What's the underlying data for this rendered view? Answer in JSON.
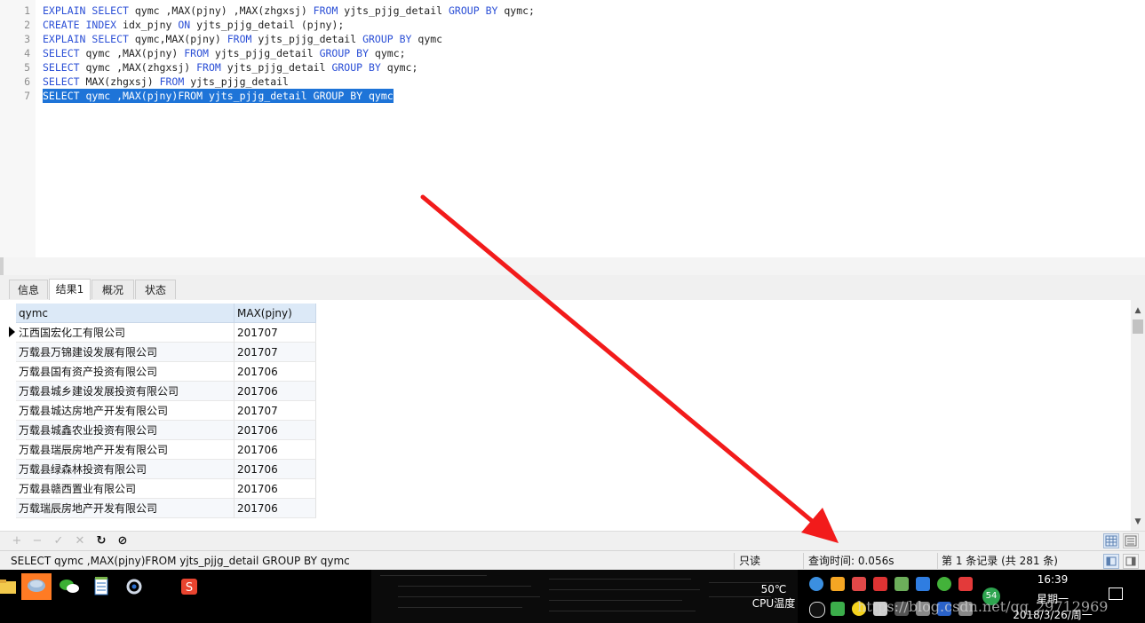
{
  "editor": {
    "lines": [
      {
        "n": "1",
        "tokens": [
          [
            "kw",
            "EXPLAIN"
          ],
          [
            "t",
            " "
          ],
          [
            "kw",
            "SELECT"
          ],
          [
            "t",
            " qymc ,MAX(pjny) ,MAX(zhgxsj) "
          ],
          [
            "kw",
            "FROM"
          ],
          [
            "t",
            " yjts_pjjg_detail "
          ],
          [
            "kw",
            "GROUP"
          ],
          [
            "t",
            " "
          ],
          [
            "kw",
            "BY"
          ],
          [
            "t",
            " qymc;"
          ]
        ]
      },
      {
        "n": "2",
        "tokens": [
          [
            "kw",
            "CREATE"
          ],
          [
            "t",
            " "
          ],
          [
            "kw",
            "INDEX"
          ],
          [
            "t",
            " idx_pjny "
          ],
          [
            "kw",
            "ON"
          ],
          [
            "t",
            " yjts_pjjg_detail (pjny);"
          ]
        ]
      },
      {
        "n": "3",
        "tokens": [
          [
            "kw",
            "EXPLAIN"
          ],
          [
            "t",
            " "
          ],
          [
            "kw",
            "SELECT"
          ],
          [
            "t",
            " qymc,MAX(pjny) "
          ],
          [
            "kw",
            "FROM"
          ],
          [
            "t",
            " yjts_pjjg_detail "
          ],
          [
            "kw",
            "GROUP"
          ],
          [
            "t",
            " "
          ],
          [
            "kw",
            "BY"
          ],
          [
            "t",
            " qymc"
          ]
        ]
      },
      {
        "n": "4",
        "tokens": [
          [
            "kw",
            "SELECT"
          ],
          [
            "t",
            " qymc ,MAX(pjny) "
          ],
          [
            "kw",
            "FROM"
          ],
          [
            "t",
            " yjts_pjjg_detail "
          ],
          [
            "kw",
            "GROUP"
          ],
          [
            "t",
            " "
          ],
          [
            "kw",
            "BY"
          ],
          [
            "t",
            " qymc;"
          ]
        ]
      },
      {
        "n": "5",
        "tokens": [
          [
            "kw",
            "SELECT"
          ],
          [
            "t",
            " qymc ,MAX(zhgxsj) "
          ],
          [
            "kw",
            "FROM"
          ],
          [
            "t",
            " yjts_pjjg_detail "
          ],
          [
            "kw",
            "GROUP"
          ],
          [
            "t",
            " "
          ],
          [
            "kw",
            "BY"
          ],
          [
            "t",
            " qymc;"
          ]
        ]
      },
      {
        "n": "6",
        "tokens": [
          [
            "kw",
            "SELECT"
          ],
          [
            "t",
            " MAX(zhgxsj) "
          ],
          [
            "kw",
            "FROM"
          ],
          [
            "t",
            " yjts_pjjg_detail"
          ]
        ]
      },
      {
        "n": "7",
        "tokens": [
          [
            "kw",
            "SELECT"
          ],
          [
            "t",
            " qymc ,MAX(pjny)"
          ],
          [
            "kw",
            "FROM"
          ],
          [
            "t",
            " yjts_pjjg_detail "
          ],
          [
            "kw",
            "GROUP"
          ],
          [
            "t",
            " "
          ],
          [
            "kw",
            "BY"
          ],
          [
            "t",
            " qymc"
          ]
        ],
        "selected": true
      }
    ]
  },
  "tabs": [
    "信息",
    "结果1",
    "概况",
    "状态"
  ],
  "active_tab": 1,
  "grid": {
    "columns": [
      "qymc",
      "MAX(pjny)"
    ],
    "rows": [
      [
        "江西国宏化工有限公司",
        "201707"
      ],
      [
        "万载县万锦建设发展有限公司",
        "201707"
      ],
      [
        "万载县国有资产投资有限公司",
        "201706"
      ],
      [
        "万载县城乡建设发展投资有限公司",
        "201706"
      ],
      [
        "万载县城达房地产开发有限公司",
        "201707"
      ],
      [
        "万载县城鑫农业投资有限公司",
        "201706"
      ],
      [
        "万载县瑞辰房地产开发有限公司",
        "201706"
      ],
      [
        "万载县绿森林投资有限公司",
        "201706"
      ],
      [
        "万载县赣西置业有限公司",
        "201706"
      ],
      [
        "万载瑞辰房地产开发有限公司",
        "201706"
      ]
    ]
  },
  "toolbar": {
    "buttons": [
      {
        "name": "add-record-button",
        "glyph": "+"
      },
      {
        "name": "delete-record-button",
        "glyph": "−"
      },
      {
        "name": "apply-changes-button",
        "glyph": "✓"
      },
      {
        "name": "discard-changes-button",
        "glyph": "✕"
      },
      {
        "name": "refresh-button",
        "glyph": "↻"
      },
      {
        "name": "stop-button",
        "glyph": "⊘"
      }
    ]
  },
  "status": {
    "sql": "SELECT qymc ,MAX(pjny)FROM yjts_pjjg_detail GROUP BY qymc",
    "readonly": "只读",
    "query_time": "查询时间: 0.056s",
    "record": "第 1 条记录 (共 281 条)"
  },
  "taskbar": {
    "cpu_temp_value": "50℃",
    "cpu_temp_label": "CPU温度",
    "badge": "54",
    "time": "16:39",
    "weekday": "星期一",
    "date": "2018/3/26/周一",
    "watermark": "https://blog.csdn.net/qq_29712969",
    "colors": {
      "active_app": "#ff7b24",
      "annotation_arrow": "#f21b1b"
    }
  }
}
